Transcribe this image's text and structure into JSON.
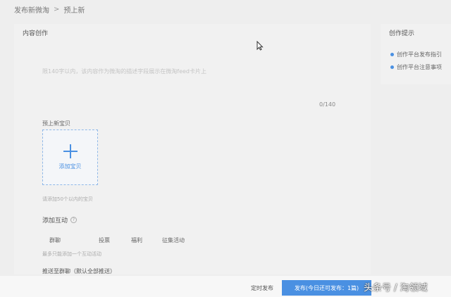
{
  "breadcrumb": {
    "parent": "发布新微淘",
    "current": "预上新"
  },
  "content_section": {
    "title": "内容创作",
    "description_placeholder": "限140字以内，该内容作为微淘的描述字段展示在微淘feed卡片上",
    "char_counter": "0/140"
  },
  "item_section": {
    "label": "预上新宝贝",
    "add_label": "添加宝贝",
    "add_hint": "请添加50个以内的宝贝"
  },
  "interaction_section": {
    "title": "添加互动",
    "tabs": [
      {
        "label": "群聊"
      },
      {
        "label": "投票"
      },
      {
        "label": "福利"
      },
      {
        "label": "征集活动"
      }
    ],
    "hint": "最多只能添加一个互动活动"
  },
  "push_section": {
    "label": "推送至群聊（默认全部推送）"
  },
  "sidebar": {
    "title": "创作提示",
    "links": [
      {
        "label": "创作平台发布指引"
      },
      {
        "label": "创作平台注意事项"
      }
    ]
  },
  "footer": {
    "schedule_label": "定时发布",
    "publish_label": "发布(今日还可发布：1篇)"
  },
  "watermark": "头条号 / 淘领域",
  "colors": {
    "accent": "#4a90e2",
    "background": "#eeeeee"
  },
  "icons": {
    "plus": "plus-icon",
    "help": "help-icon",
    "cursor": "mouse-cursor-icon"
  }
}
